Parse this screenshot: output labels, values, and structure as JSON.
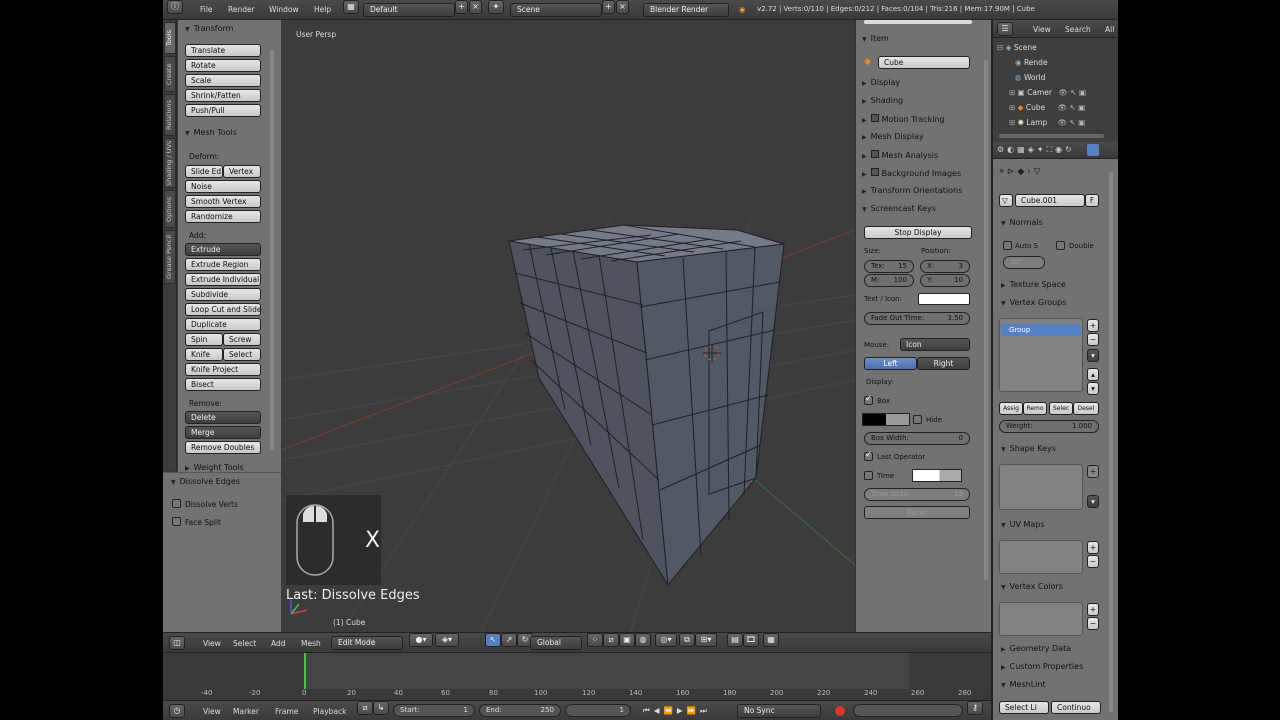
{
  "info_bar": {
    "menus": [
      "File",
      "Render",
      "Window",
      "Help"
    ],
    "layout": "Default",
    "scene": "Scene",
    "engine": "Blender Render",
    "stats": "v2.72 | Verts:0/110 | Edges:0/212 | Faces:0/104 | Tris:216 | Mem:17.90M | Cube"
  },
  "toolshelf": {
    "tabs": [
      "Tools",
      "Create",
      "Relations",
      "Shading / UVs",
      "Options",
      "Grease Pencil"
    ],
    "transform_header": "Transform",
    "transform": [
      "Translate",
      "Rotate",
      "Scale",
      "Shrink/Fatten",
      "Push/Pull"
    ],
    "mesh_tools_header": "Mesh Tools",
    "deform_label": "Deform:",
    "slide_edge": "Slide Ed",
    "vertex": "Vertex",
    "deform": [
      "Noise",
      "Smooth Vertex",
      "Randomize"
    ],
    "add_label": "Add:",
    "extrude": "Extrude",
    "add": [
      "Extrude Region",
      "Extrude Individual",
      "Subdivide",
      "Loop Cut and Slide",
      "Duplicate"
    ],
    "spin": "Spin",
    "screw": "Screw",
    "knife": "Knife",
    "select": "Select",
    "add2": [
      "Knife Project",
      "Bisect"
    ],
    "remove_label": "Remove:",
    "delete": "Delete",
    "merge": "Merge",
    "remove_doubles": "Remove Doubles",
    "weight_tools": "Weight Tools"
  },
  "redo_panel": {
    "header": "Dissolve Edges",
    "dissolve_verts": "Dissolve Verts",
    "face_split": "Face Split"
  },
  "viewport": {
    "view_name": "User Persp",
    "last_op": "Last: Dissolve Edges",
    "key": "X",
    "object_name": "(1) Cube"
  },
  "npanel": {
    "item_header": "Item",
    "item_name": "Cube",
    "collapsed": [
      "Display",
      "Shading",
      "Motion Tracking",
      "Mesh Display",
      "Mesh Analysis",
      "Background Images",
      "Transform Orientations"
    ],
    "screencast_header": "Screencast Keys",
    "stop_display": "Stop Display",
    "size_label": "Size:",
    "position_label": "Position:",
    "size_fields": [
      {
        "name": "Tex:",
        "value": "15"
      },
      {
        "name": "M:",
        "value": "100"
      }
    ],
    "pos_fields": [
      {
        "name": "X:",
        "value": "3"
      },
      {
        "name": "Y:",
        "value": "10"
      }
    ],
    "text_icon_label": "Text / Icon:",
    "fade_out": {
      "name": "Fade Out Time:",
      "value": "3.50"
    },
    "mouse_label": "Mouse:",
    "mouse_value": "Icon",
    "left": "Left",
    "right": "Right",
    "display_label": "Display:",
    "box": "Box",
    "hide": "Hide",
    "box_width": {
      "name": "Box Width:",
      "value": "0"
    },
    "last_operator": "Last Operator",
    "timer": "Time",
    "time_span": {
      "name": "Time Span:",
      "value": "13"
    },
    "reset": "Reset"
  },
  "outliner": {
    "view": "View",
    "search": "Search",
    "all": "All",
    "rows": [
      "Scene",
      "Rende",
      "World",
      "Camer",
      "Cube",
      "Lamp"
    ]
  },
  "properties": {
    "mesh_name": "Cube.001",
    "normals": "Normals",
    "auto_smooth": "Auto S",
    "double_sided": "Double",
    "angle": "30°",
    "texture_space": "Texture Space",
    "vertex_groups": "Vertex Groups",
    "group": "Group",
    "vg_buttons": [
      "Assig",
      "Remo",
      "Selec",
      "Desel"
    ],
    "weight": {
      "name": "Weight:",
      "value": "1.000"
    },
    "shape_keys": "Shape Keys",
    "uv_maps": "UV Maps",
    "vertex_colors": "Vertex Colors",
    "geometry_data": "Geometry Data",
    "custom_properties": "Custom Properties",
    "meshlint": "MeshLint",
    "select_lint": "Select Li",
    "continuous": "Continuo"
  },
  "view3d_header": {
    "menus": [
      "View",
      "Select",
      "Add",
      "Mesh"
    ],
    "mode": "Edit Mode",
    "orientation": "Global"
  },
  "timeline": {
    "ticks": [
      "-40",
      "-20",
      "0",
      "20",
      "40",
      "60",
      "80",
      "100",
      "120",
      "140",
      "160",
      "180",
      "200",
      "220",
      "240",
      "260",
      "280"
    ],
    "menus": [
      "View",
      "Marker",
      "Frame",
      "Playback"
    ],
    "start": {
      "name": "Start:",
      "value": "1"
    },
    "end": {
      "name": "End:",
      "value": "250"
    },
    "current": "1",
    "sync": "No Sync"
  },
  "colors": {
    "accent": "#5680c2",
    "panel": "#727272",
    "viewport": "#3c3c3c",
    "playhead": "#4fbf4f"
  }
}
